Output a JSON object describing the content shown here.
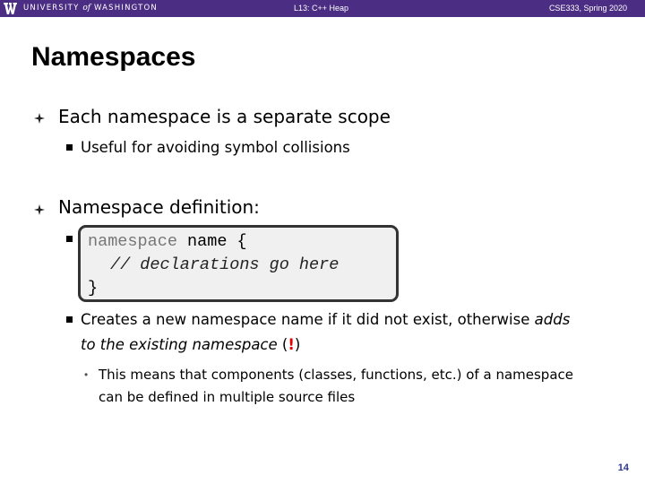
{
  "header": {
    "university_prefix": "UNIVERSITY",
    "university_of": "of",
    "university_suffix": "WASHINGTON",
    "lecture": "L13: C++ Heap",
    "course": "CSE333, Spring 2020"
  },
  "slide": {
    "title": "Namespaces",
    "bullets": {
      "b1": "Each namespace is a separate scope",
      "b1_sub1": "Useful for avoiding symbol collisions",
      "b2": "Namespace definition:",
      "code": {
        "line1_keyword": "namespace",
        "line1_rest": " name {",
        "line2": "// declarations go here",
        "line3": "}"
      },
      "b2_sub2": {
        "line1_start": "Creates a new namespace name if it did not exist, otherwise ",
        "line1_em": "adds",
        "line2_em": "to the existing namespace",
        "line2_open": " (",
        "line2_bang": "!",
        "line2_close": ")"
      },
      "b2_sub2_sub": {
        "line1": "This means that components (classes, functions, etc.) of a namespace",
        "line2": "can be defined in multiple source files"
      }
    },
    "page_number": "14"
  },
  "colors": {
    "header_bg": "#4b2e83",
    "code_bg": "#f0f0f0",
    "emphasis": "#e00000",
    "page_number": "#2b3a8f"
  }
}
